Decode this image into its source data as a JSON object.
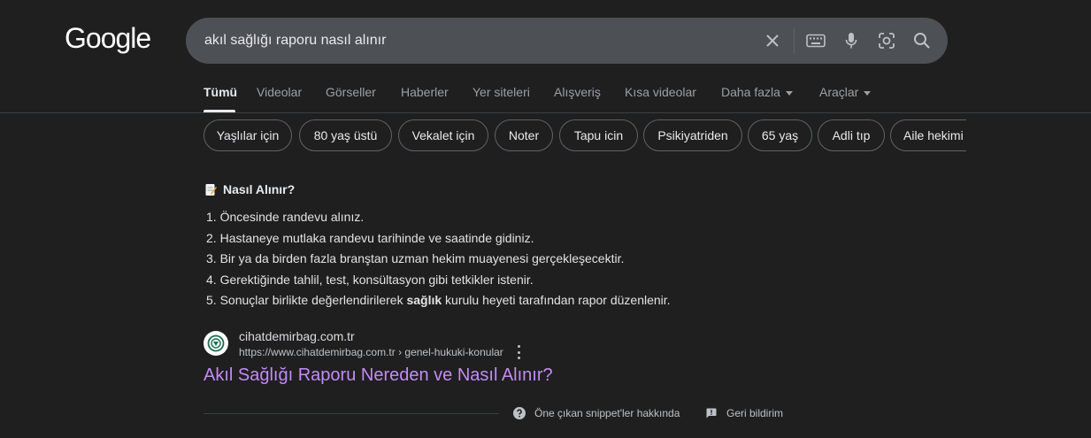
{
  "logo": "Google",
  "search": {
    "query": "akıl sağlığı raporu nasıl alınır",
    "icons": [
      "close-icon",
      "keyboard-icon",
      "microphone-icon",
      "lens-icon",
      "search-icon"
    ]
  },
  "tabs": [
    {
      "label": "Tümü",
      "active": true
    },
    {
      "label": "Videolar"
    },
    {
      "label": "Görseller"
    },
    {
      "label": "Haberler"
    },
    {
      "label": "Yer siteleri"
    },
    {
      "label": "Alışveriş"
    },
    {
      "label": "Kısa videolar"
    },
    {
      "label": "Daha fazla"
    },
    {
      "label": "Araçlar"
    }
  ],
  "chips": [
    "Yaşlılar için",
    "80 yaş üstü",
    "Vekalet için",
    "Noter",
    "Tapu icin",
    "Psikiyatriden",
    "65 yaş",
    "Adli tıp",
    "Aile hekimi"
  ],
  "snippet": {
    "heading": "Nasıl Alınır?",
    "steps": [
      {
        "num": "1.",
        "text": "Öncesinde randevu alınız."
      },
      {
        "num": "2.",
        "text": "Hastaneye mutlaka randevu tarihinde ve saatinde gidiniz."
      },
      {
        "num": "3.",
        "text": "Bir ya da birden fazla branştan uzman hekim muayenesi gerçekleşecektir."
      },
      {
        "num": "4.",
        "text": "Gerektiğinde tahlil, test, konsültasyon gibi tetkikler istenir."
      },
      {
        "num": "5.",
        "pre": "Sonuçlar birlikte değerlendirilerek ",
        "bold": "sağlık",
        "post": " kurulu heyeti tarafından rapor düzenlenir."
      }
    ]
  },
  "source": {
    "site_name": "cihatdemirbag.com.tr",
    "url": "https://www.cihatdemirbag.com.tr › genel-hukuki-konular",
    "title": "Akıl Sağlığı Raporu Nereden ve Nasıl Alınır?"
  },
  "footer": {
    "about": "Öne çıkan snippet'ler hakkında",
    "feedback": "Geri bildirim"
  },
  "colors": {
    "background": "#1f1f1f",
    "searchbar": "#4d5156",
    "link_visited": "#c58af9",
    "text": "#e8eaed",
    "muted": "#9aa0a6"
  }
}
